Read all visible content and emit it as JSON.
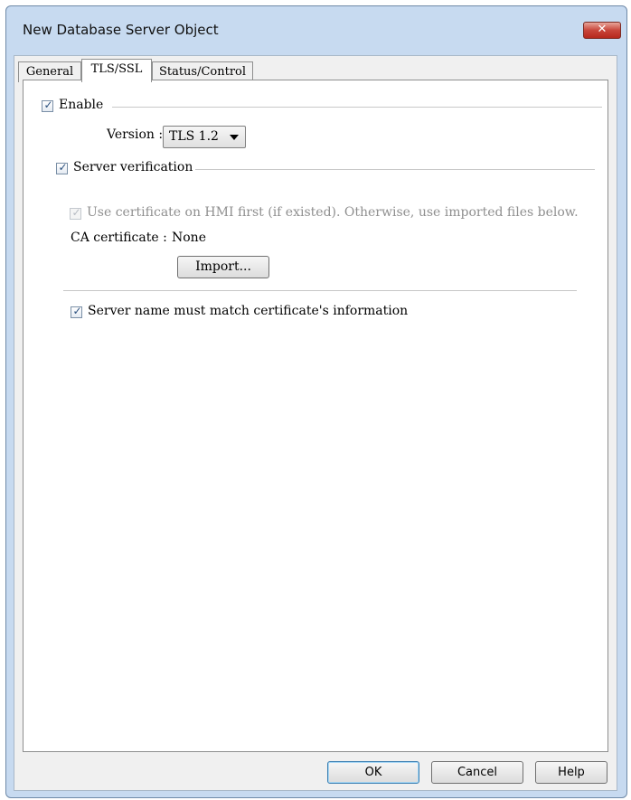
{
  "window": {
    "title": "New Database Server Object",
    "close_symbol": "✕"
  },
  "tabs": [
    {
      "label": "General",
      "active": false
    },
    {
      "label": "TLS/SSL",
      "active": true
    },
    {
      "label": "Status/Control",
      "active": false
    }
  ],
  "tls": {
    "enable": {
      "label": "Enable",
      "checked": true
    },
    "version": {
      "label": "Version :",
      "selected": "TLS 1.2"
    },
    "server_verification": {
      "label": "Server verification",
      "checked": true
    },
    "use_hmi_cert": {
      "label": "Use certificate on HMI first (if existed). Otherwise, use imported files below.",
      "checked": true,
      "enabled": false
    },
    "ca_certificate": {
      "label": "CA certificate :",
      "value": "None"
    },
    "import_button": "Import...",
    "server_name_match": {
      "label": "Server name must match certificate's information",
      "checked": true
    }
  },
  "check_glyph": "✓",
  "footer": {
    "ok": "OK",
    "cancel": "Cancel",
    "help": "Help"
  }
}
